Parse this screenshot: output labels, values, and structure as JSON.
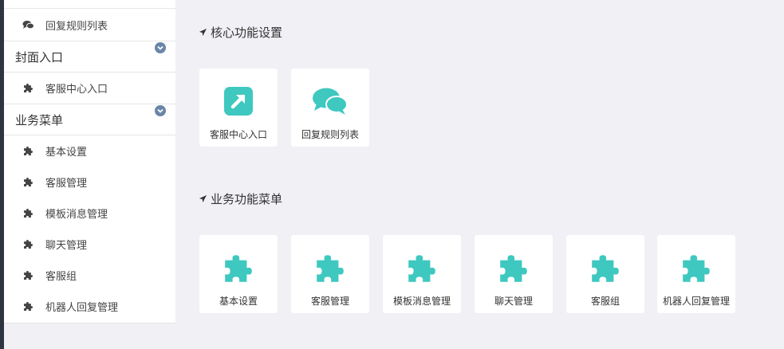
{
  "colors": {
    "accent": "#3ec8c0",
    "sidebar_bg": "#ffffff",
    "page_bg": "#f0f0f5",
    "chevron": "#6a86a8"
  },
  "sidebar": {
    "top_item": {
      "label": "回复规则列表",
      "icon": "comments-icon"
    },
    "groups": [
      {
        "title": "封面入口",
        "items": [
          {
            "label": "客服中心入口",
            "icon": "puzzle-icon"
          }
        ]
      },
      {
        "title": "业务菜单",
        "items": [
          {
            "label": "基本设置",
            "icon": "puzzle-icon"
          },
          {
            "label": "客服管理",
            "icon": "puzzle-icon"
          },
          {
            "label": "模板消息管理",
            "icon": "puzzle-icon"
          },
          {
            "label": "聊天管理",
            "icon": "puzzle-icon"
          },
          {
            "label": "客服组",
            "icon": "puzzle-icon"
          },
          {
            "label": "机器人回复管理",
            "icon": "puzzle-icon"
          }
        ]
      }
    ]
  },
  "main": {
    "sections": [
      {
        "title": "核心功能设置",
        "tiles": [
          {
            "label": "客服中心入口",
            "icon": "external-link-icon"
          },
          {
            "label": "回复规则列表",
            "icon": "comments-icon"
          }
        ]
      },
      {
        "title": "业务功能菜单",
        "tiles": [
          {
            "label": "基本设置",
            "icon": "puzzle-icon"
          },
          {
            "label": "客服管理",
            "icon": "puzzle-icon"
          },
          {
            "label": "模板消息管理",
            "icon": "puzzle-icon"
          },
          {
            "label": "聊天管理",
            "icon": "puzzle-icon"
          },
          {
            "label": "客服组",
            "icon": "puzzle-icon"
          },
          {
            "label": "机器人回复管理",
            "icon": "puzzle-icon"
          }
        ]
      }
    ]
  }
}
